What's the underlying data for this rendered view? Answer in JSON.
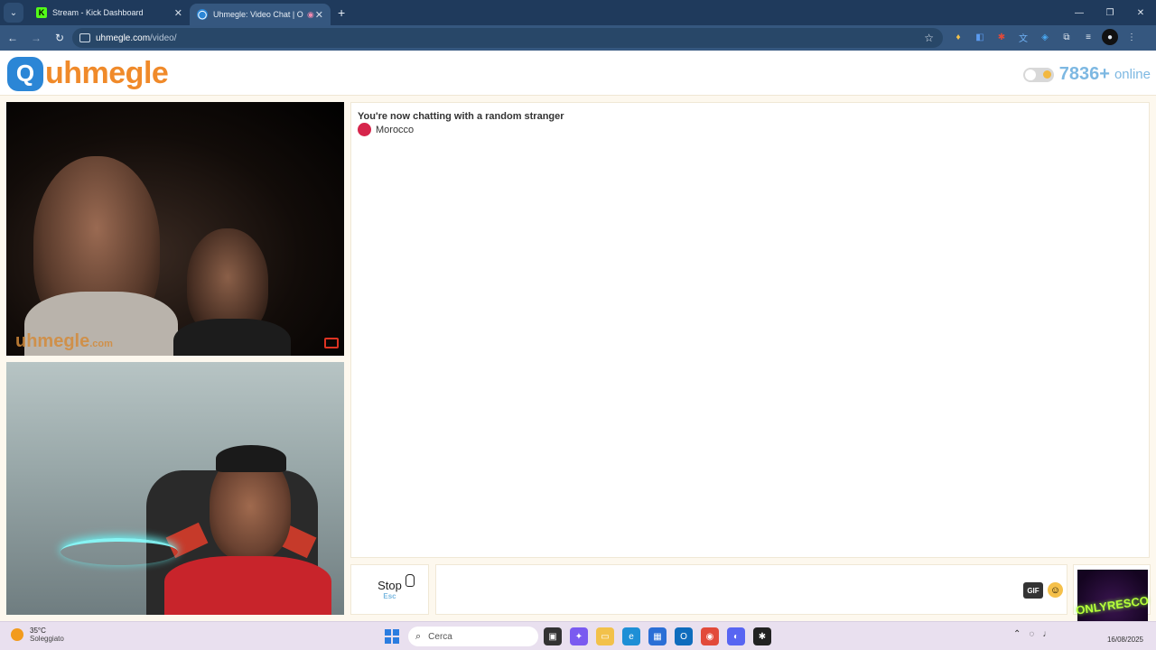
{
  "browser": {
    "tabs": [
      {
        "title": "Stream - Kick Dashboard",
        "favicon": "kick-icon",
        "active": false
      },
      {
        "title": "Uhmegle: Video Chat | Ome",
        "favicon": "uhmegle-icon",
        "active": true
      }
    ],
    "new_tab": "+",
    "url_host": "uhmegle.com",
    "url_path": "/video/"
  },
  "site": {
    "logo_text": "uhmegle",
    "online_count": "7836+",
    "online_label": "online"
  },
  "stranger_video": {
    "watermark": "uhmegle",
    "watermark_suffix": ".com"
  },
  "chat": {
    "status": "You're now chatting with a random stranger",
    "country": "Morocco",
    "country_color": "#d6254b"
  },
  "controls": {
    "stop_label": "Stop",
    "stop_key": "Esc",
    "gif_label": "GIF"
  },
  "overlay": {
    "logo_text": "ONLYRESCO"
  },
  "taskbar": {
    "temperature": "35°C",
    "weather": "Soleggiato",
    "search_placeholder": "Cerca",
    "date": "16/08/2025"
  },
  "colors": {
    "brand_blue": "#2b86d6",
    "brand_orange": "#f08a2a",
    "online_blue": "#7db8e2"
  }
}
